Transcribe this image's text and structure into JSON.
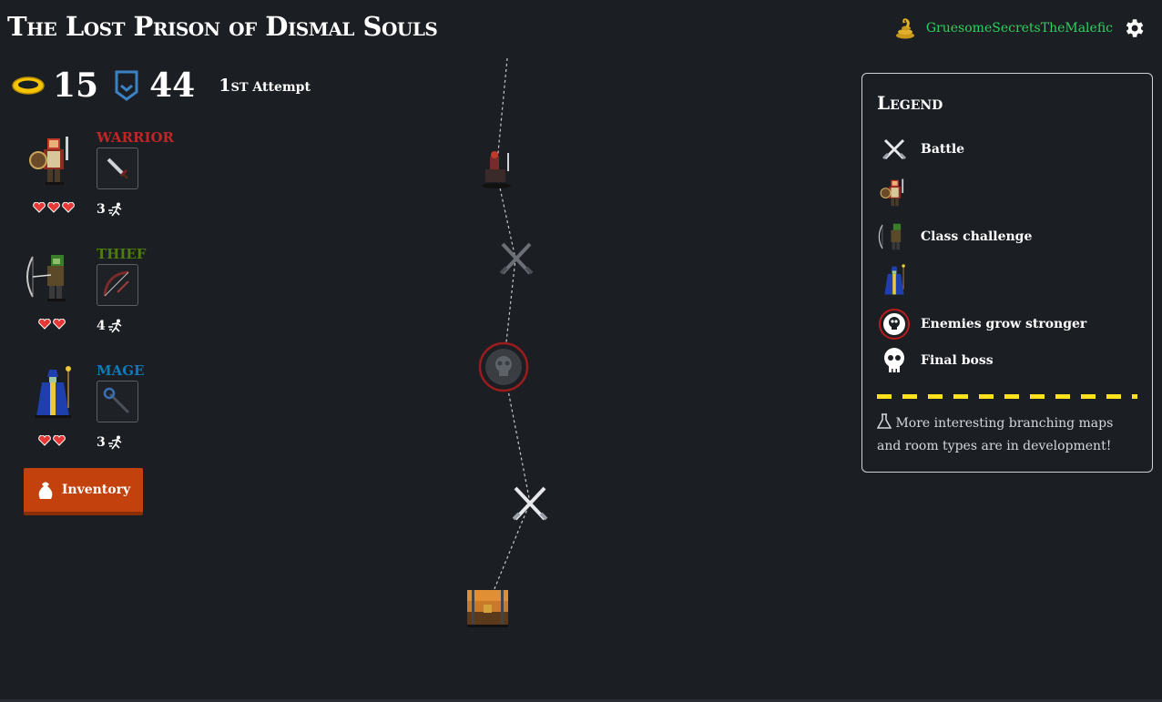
{
  "header": {
    "title": "The Lost Prison of Dismal Souls",
    "username": "GruesomeSecretsTheMalefic",
    "user_icon": "snake-icon",
    "settings_icon": "gear-icon"
  },
  "stats": {
    "gold": "15",
    "shield": "44",
    "attempt_ordinal": "1st",
    "attempt_label": "Attempt"
  },
  "party": [
    {
      "class": "WARRIOR",
      "class_color": "#c02626",
      "hearts": 3,
      "moves": "3",
      "item_icon": "sword-icon",
      "sprite": "warrior-sprite"
    },
    {
      "class": "THIEF",
      "class_color": "#4d7c0f",
      "hearts": 2,
      "moves": "4",
      "item_icon": "bow-icon",
      "sprite": "thief-sprite"
    },
    {
      "class": "MAGE",
      "class_color": "#0e7ab8",
      "hearts": 2,
      "moves": "3",
      "item_icon": "staff-icon",
      "sprite": "mage-sprite"
    }
  ],
  "inventory_button": {
    "label": "Inventory",
    "icon": "loot-bag-icon"
  },
  "map": {
    "nodes": [
      {
        "type": "class-challenge-warrior"
      },
      {
        "type": "battle",
        "state": "inactive"
      },
      {
        "type": "enemies-grow-stronger"
      },
      {
        "type": "battle",
        "state": "active"
      },
      {
        "type": "treasure-chest"
      }
    ]
  },
  "legend": {
    "title": "Legend",
    "items": [
      {
        "icon": "crossed-swords-icon",
        "label": "Battle"
      },
      {
        "icon": "warrior-sprite",
        "label": ""
      },
      {
        "icon": "archer-sprite",
        "label": "Class challenge"
      },
      {
        "icon": "mage-sprite",
        "label": ""
      },
      {
        "icon": "skull-ring-icon",
        "label": "Enemies grow stronger"
      },
      {
        "icon": "skull-icon",
        "label": "Final boss"
      }
    ],
    "note": "More interesting branching maps and room types are in development!",
    "note_icon": "flask-icon"
  },
  "colors": {
    "background": "#1b1e23",
    "username": "#2fd15c",
    "inventory": "#c2410c",
    "gold": "#f5c400",
    "shield": "#3b82c4",
    "heart": "#e53935",
    "danger_ring": "#b91c1c",
    "stripe": "#ffe21a"
  }
}
